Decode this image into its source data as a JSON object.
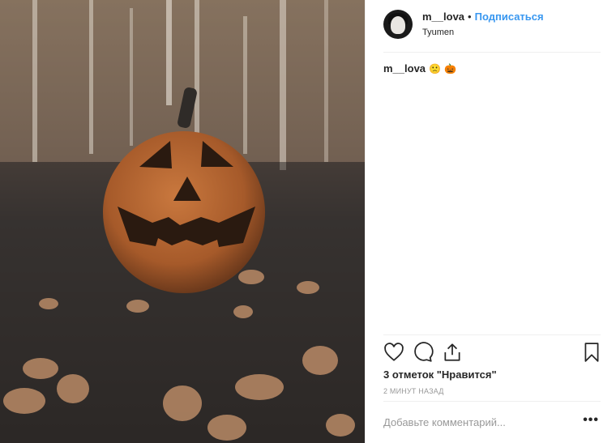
{
  "post": {
    "username": "m__lova",
    "separator": "•",
    "follow_label": "Подписаться",
    "location": "Tyumen",
    "caption_user": "m__lova",
    "caption_emoji_1": "🙁",
    "caption_emoji_2": "🎃",
    "likes_text": "3 отметок \"Нравится\"",
    "time_text": "2 МИНУТ НАЗАД",
    "comment_placeholder": "Добавьте комментарий...",
    "more_label": "•••"
  },
  "icons": [
    "heart-icon",
    "comment-icon",
    "share-icon",
    "bookmark-icon"
  ],
  "colors": {
    "link": "#3897f0",
    "text": "#262626",
    "muted": "#999999",
    "divider": "#efefef"
  }
}
